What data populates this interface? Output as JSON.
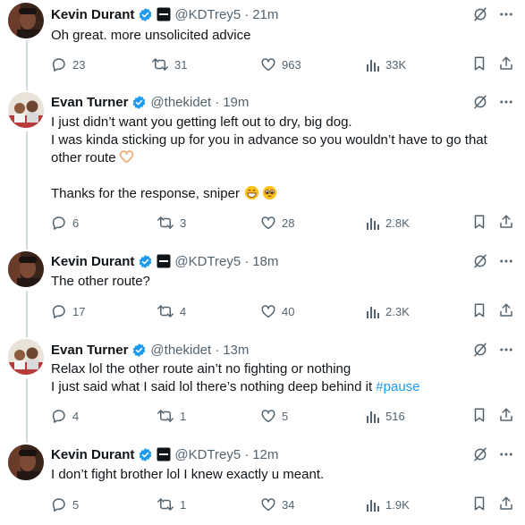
{
  "tweets": [
    {
      "name": "Kevin Durant",
      "handle": "@KDTrey5",
      "time": "21m",
      "affiliate": true,
      "lines": [
        "Oh great. more unsolicited advice"
      ],
      "replies": "23",
      "reposts": "31",
      "likes": "963",
      "views": "33K",
      "avatar": "kd"
    },
    {
      "name": "Evan Turner",
      "handle": "@thekidet",
      "time": "19m",
      "affiliate": false,
      "lines": [
        "I just didn’t want you getting left out to dry, big dog.",
        "I was kinda sticking up for you in advance so you wouldn’t have to go that",
        "other route",
        "",
        "Thanks for the response, sniper"
      ],
      "emoji_names": [
        "heart-hands-emoji",
        "grinning-emoji",
        "pleading-emoji"
      ],
      "replies": "6",
      "reposts": "3",
      "likes": "28",
      "views": "2.8K",
      "avatar": "et"
    },
    {
      "name": "Kevin Durant",
      "handle": "@KDTrey5",
      "time": "18m",
      "affiliate": true,
      "lines": [
        "The other route?"
      ],
      "replies": "17",
      "reposts": "4",
      "likes": "40",
      "views": "2.3K",
      "avatar": "kd"
    },
    {
      "name": "Evan Turner",
      "handle": "@thekidet",
      "time": "13m",
      "affiliate": false,
      "lines": [
        "Relax lol the other route ain’t no fighting or nothing",
        "I just said what I said lol there’s nothing deep behind it"
      ],
      "hashtag": "#pause",
      "replies": "4",
      "reposts": "1",
      "likes": "5",
      "views": "516",
      "avatar": "et"
    },
    {
      "name": "Kevin Durant",
      "handle": "@KDTrey5",
      "time": "12m",
      "affiliate": true,
      "lines": [
        "I don’t fight brother lol I knew exactly u meant."
      ],
      "replies": "5",
      "reposts": "1",
      "likes": "34",
      "views": "1.9K",
      "avatar": "kd"
    }
  ],
  "separator": "·",
  "colors": {
    "text": "#0f1419",
    "muted": "#536471",
    "accent": "#1d9bf0",
    "thread_line": "#cfd9de"
  },
  "icons": [
    "verified-badge-icon",
    "affiliate-badge-icon",
    "grok-icon",
    "more-icon",
    "reply-icon",
    "repost-icon",
    "like-icon",
    "views-icon",
    "bookmark-icon",
    "share-icon"
  ]
}
